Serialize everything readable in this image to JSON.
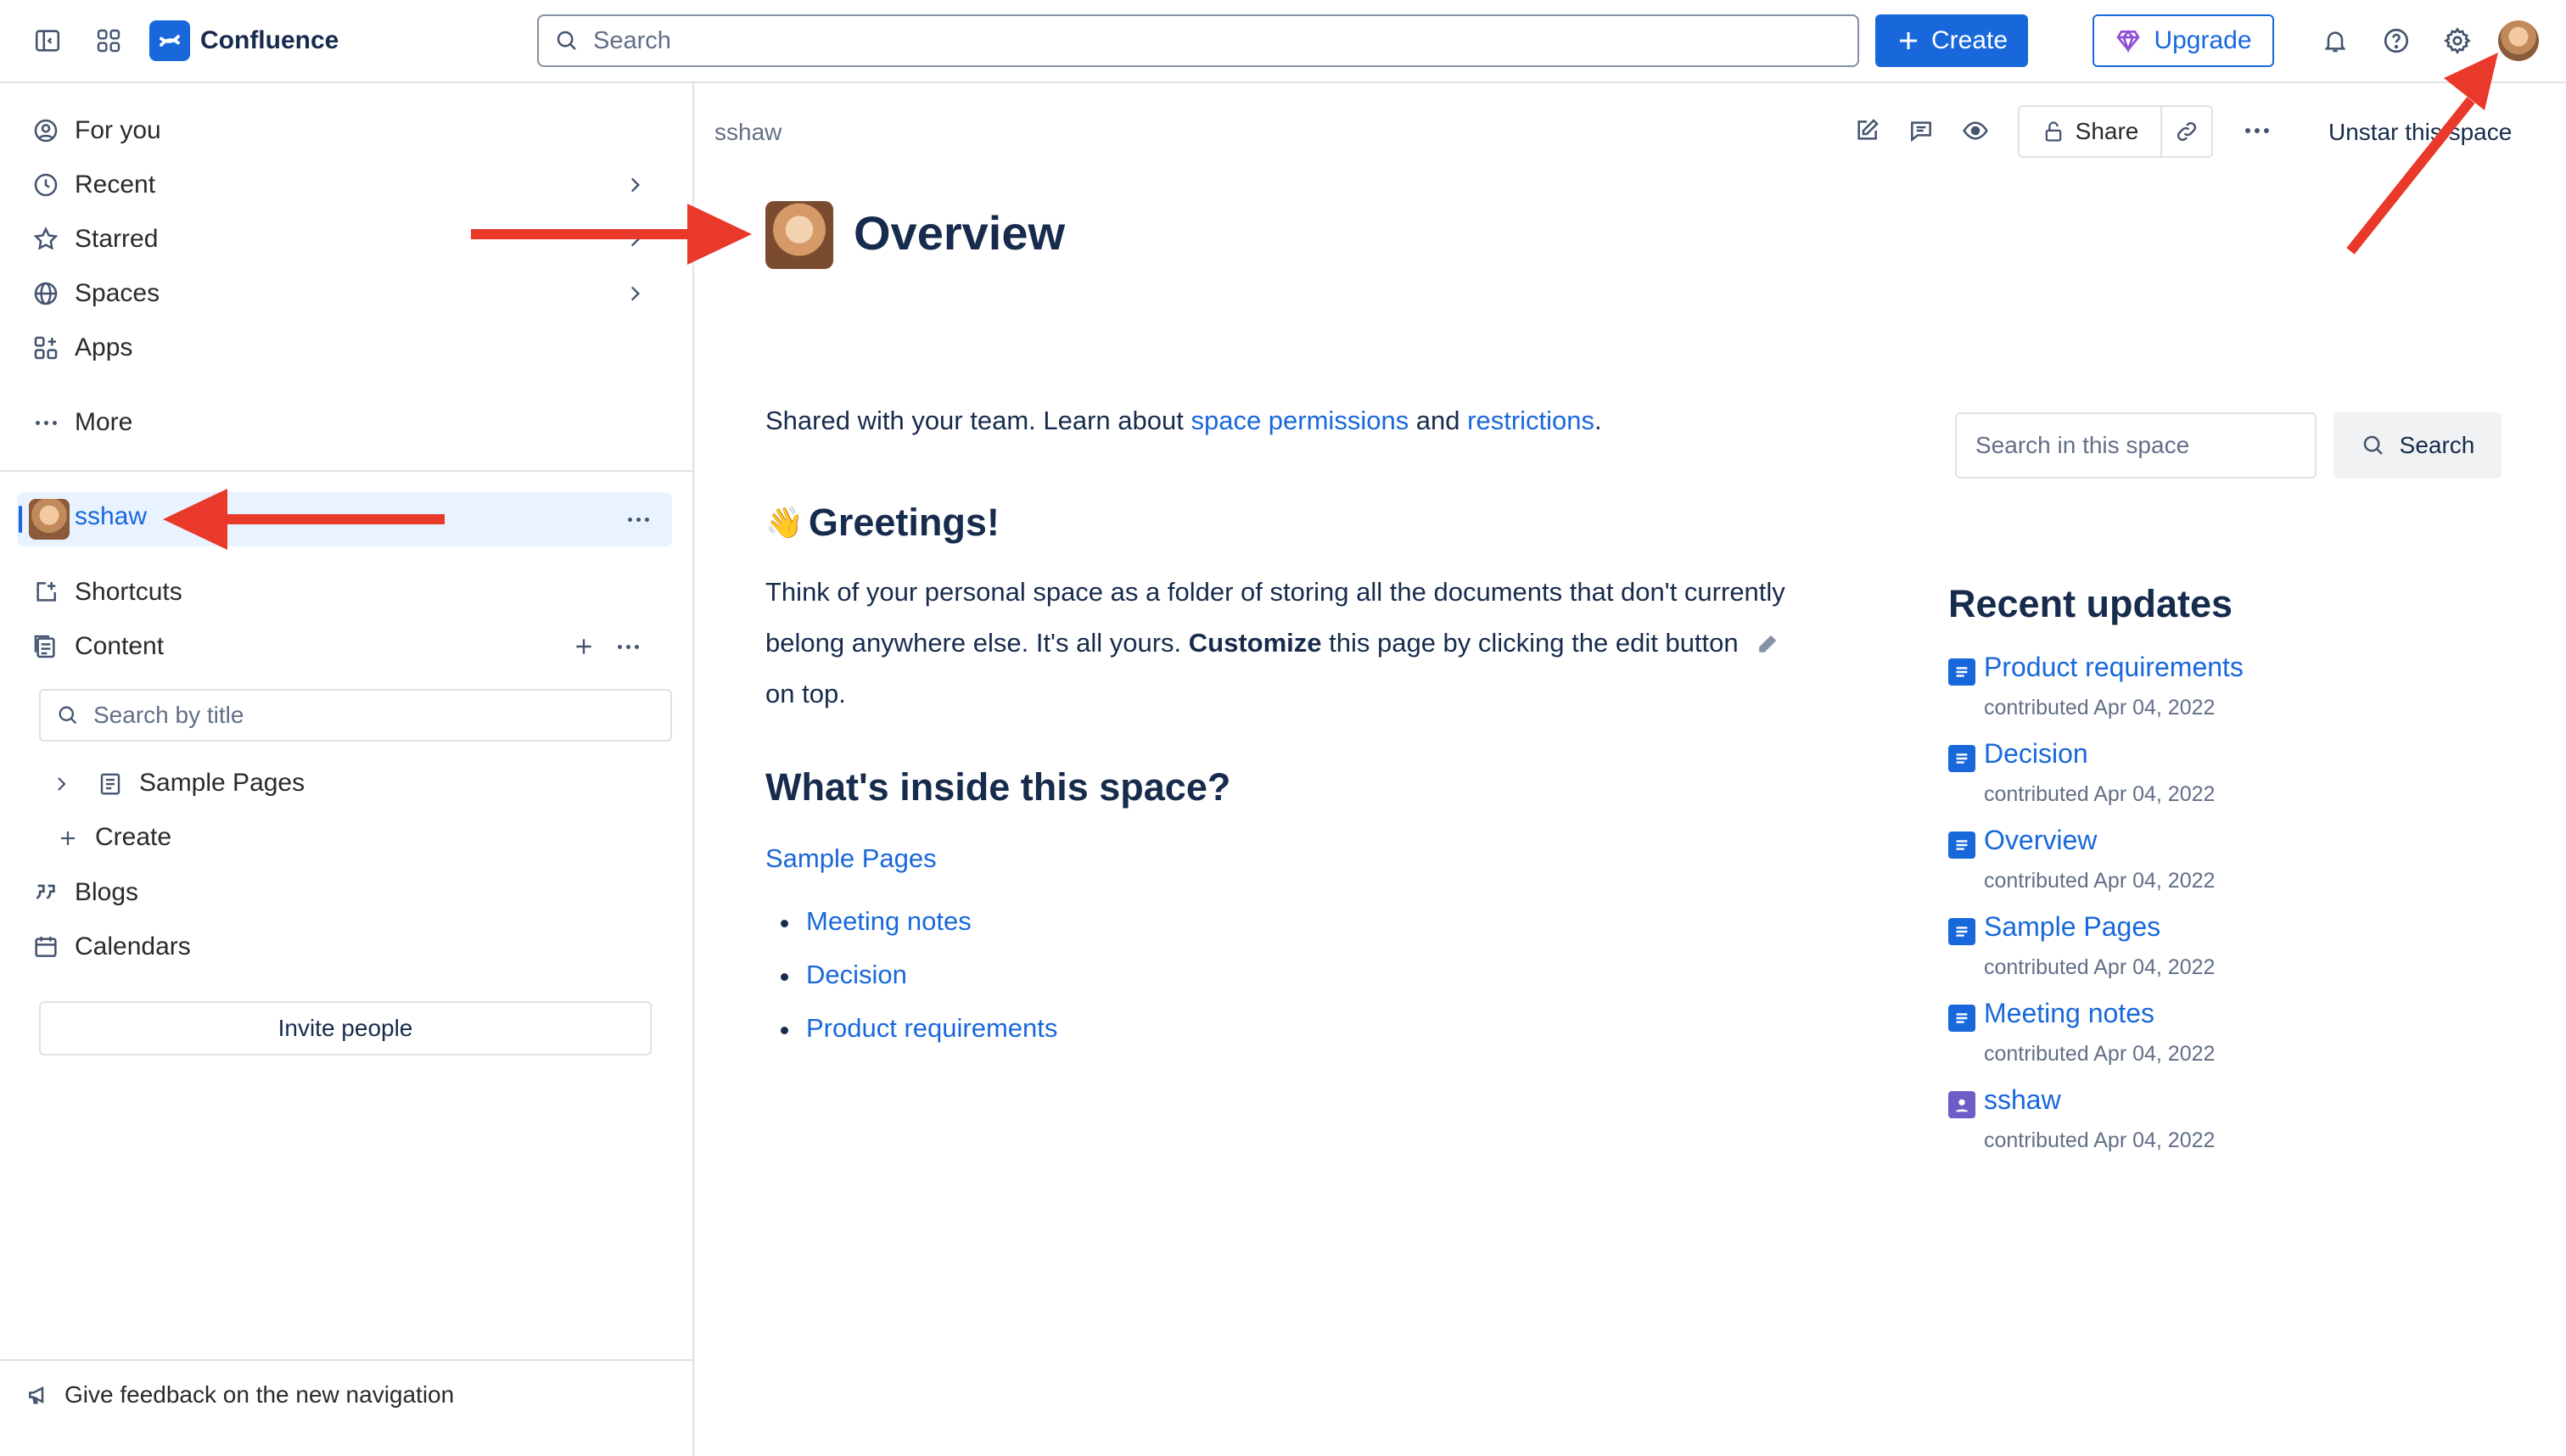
{
  "topbar": {
    "app_name": "Confluence",
    "search_placeholder": "Search",
    "create_label": "Create",
    "upgrade_label": "Upgrade"
  },
  "sidebar": {
    "items": [
      {
        "label": "For you",
        "icon": "user-circle-icon"
      },
      {
        "label": "Recent",
        "icon": "clock-icon"
      },
      {
        "label": "Starred",
        "icon": "star-icon"
      },
      {
        "label": "Spaces",
        "icon": "globe-icon"
      },
      {
        "label": "Apps",
        "icon": "apps-icon"
      }
    ],
    "more_label": "More",
    "space_name": "sshaw",
    "shortcuts_label": "Shortcuts",
    "content_label": "Content",
    "title_search_placeholder": "Search by title",
    "tree": {
      "sample_pages": "Sample Pages",
      "create": "Create"
    },
    "blogs_label": "Blogs",
    "calendars_label": "Calendars",
    "invite_label": "Invite people",
    "feedback_label": "Give feedback on the new navigation"
  },
  "page": {
    "breadcrumb": "sshaw",
    "share_label": "Share",
    "unstar_label": "Unstar this space",
    "title": "Overview",
    "intro": {
      "before": "Shared with your team. Learn about ",
      "link1": "space permissions",
      "mid": " and ",
      "link2": "restrictions",
      "after": "."
    },
    "greeting_emoji": "👋",
    "greeting_heading": "Greetings!",
    "body": {
      "before": "Think of your personal space as a folder of storing all the documents that don't currently belong anywhere else. It's all yours. ",
      "bold": "Customize",
      "after": " this page by clicking the edit button",
      "end": "on top."
    },
    "inside_heading": "What's inside this space?",
    "sample_link": "Sample Pages",
    "bullets": [
      "Meeting notes",
      "Decision",
      "Product requirements"
    ]
  },
  "right_panel": {
    "search_placeholder": "Search in this space",
    "search_button": "Search",
    "recent_title": "Recent updates",
    "updates": [
      {
        "title": "Product requirements",
        "meta": "contributed Apr 04, 2022",
        "type": "page"
      },
      {
        "title": "Decision",
        "meta": "contributed Apr 04, 2022",
        "type": "page"
      },
      {
        "title": "Overview",
        "meta": "contributed Apr 04, 2022",
        "type": "page"
      },
      {
        "title": "Sample Pages",
        "meta": "contributed Apr 04, 2022",
        "type": "page"
      },
      {
        "title": "Meeting notes",
        "meta": "contributed Apr 04, 2022",
        "type": "page"
      },
      {
        "title": "sshaw",
        "meta": "contributed Apr 04, 2022",
        "type": "space"
      }
    ]
  },
  "colors": {
    "accent": "#1868db",
    "annotation_arrow": "#e8392a",
    "page_icon": "#1868db",
    "space_icon": "#6e5dc6"
  }
}
